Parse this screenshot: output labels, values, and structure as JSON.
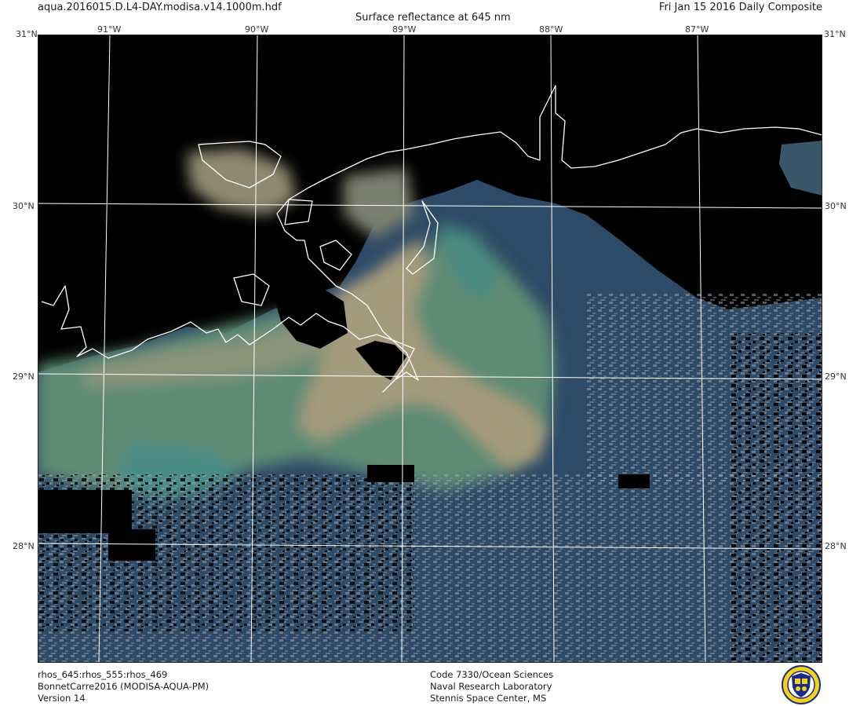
{
  "header": {
    "filename": "aqua.2016015.D.L4-DAY.modisa.v14.1000m.hdf",
    "title": "Surface reflectance at 645 nm",
    "date": "Fri Jan 15 2016 Daily Composite"
  },
  "map": {
    "top_lon_labels": [
      "91°W",
      "90°W",
      "89°W",
      "88°W",
      "87°W"
    ],
    "lat_labels": [
      "30°N",
      "29°N",
      "28°N"
    ],
    "corner_top_left": "31°N",
    "corner_top_right": "31°N",
    "colors": {
      "land": "#000000",
      "coast": "#ffffff",
      "grid": "#ffffff",
      "sediment": "#a89a7c",
      "green_water": "#5d8a73",
      "deep_water": "#2a4866",
      "cloud": "#8e94a8"
    }
  },
  "footer": {
    "left": [
      "rhos_645:rhos_555:rhos_469",
      "BonnetCarre2016 (MODISA-AQUA-PM)",
      "Version 14"
    ],
    "center": [
      "Code 7330/Ocean Sciences",
      "Naval Research Laboratory",
      "Stennis Space Center, MS"
    ]
  }
}
